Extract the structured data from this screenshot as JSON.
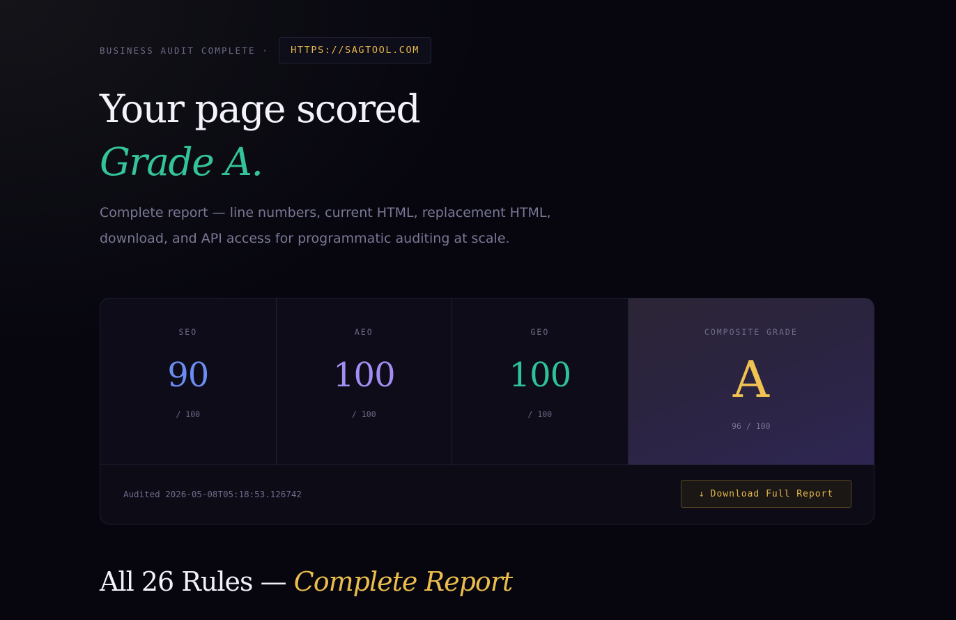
{
  "header": {
    "eyebrow": "BUSINESS AUDIT COMPLETE ·",
    "url": "HTTPS://SAGTOOL.COM"
  },
  "headline": {
    "line1": "Your page scored",
    "line2": "Grade A."
  },
  "subtitle": "Complete report — line numbers, current HTML, replacement HTML, download, and API access for programmatic auditing at scale.",
  "scores": {
    "seo": {
      "label": "SEO",
      "value": "90",
      "outof": "/ 100"
    },
    "aeo": {
      "label": "AEO",
      "value": "100",
      "outof": "/ 100"
    },
    "geo": {
      "label": "GEO",
      "value": "100",
      "outof": "/ 100"
    },
    "composite": {
      "label": "COMPOSITE GRADE",
      "value": "A",
      "outof": "96 / 100"
    }
  },
  "footer": {
    "audited": "Audited 2026-05-08T05:18:53.126742",
    "download_arrow": "↓",
    "download_label": "Download Full Report"
  },
  "section": {
    "title_main": "All 26 Rules —",
    "title_accent": "Complete Report"
  },
  "colors": {
    "background": "#07060f",
    "accent_gold": "#e8b949",
    "grade_green": "#34c49a",
    "seo_blue": "#6b8cf0",
    "aeo_purple": "#a38cf2",
    "geo_green": "#2fc29a"
  }
}
